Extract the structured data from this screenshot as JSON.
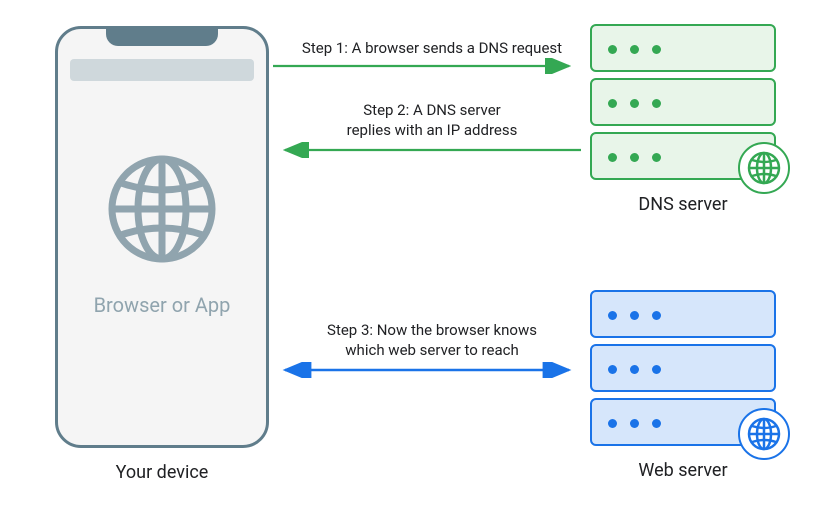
{
  "device": {
    "app_label": "Browser or App",
    "caption": "Your device"
  },
  "dns": {
    "caption": "DNS server"
  },
  "web": {
    "caption": "Web server"
  },
  "steps": {
    "s1": "Step 1: A browser sends a DNS request",
    "s2_line1": "Step 2: A DNS server",
    "s2_line2": "replies with an IP address",
    "s3_line1": "Step 3: Now the browser knows",
    "s3_line2": "which web server to reach"
  },
  "colors": {
    "green": "#34A853",
    "blue": "#1A73E8",
    "slate": "#607D8B"
  }
}
